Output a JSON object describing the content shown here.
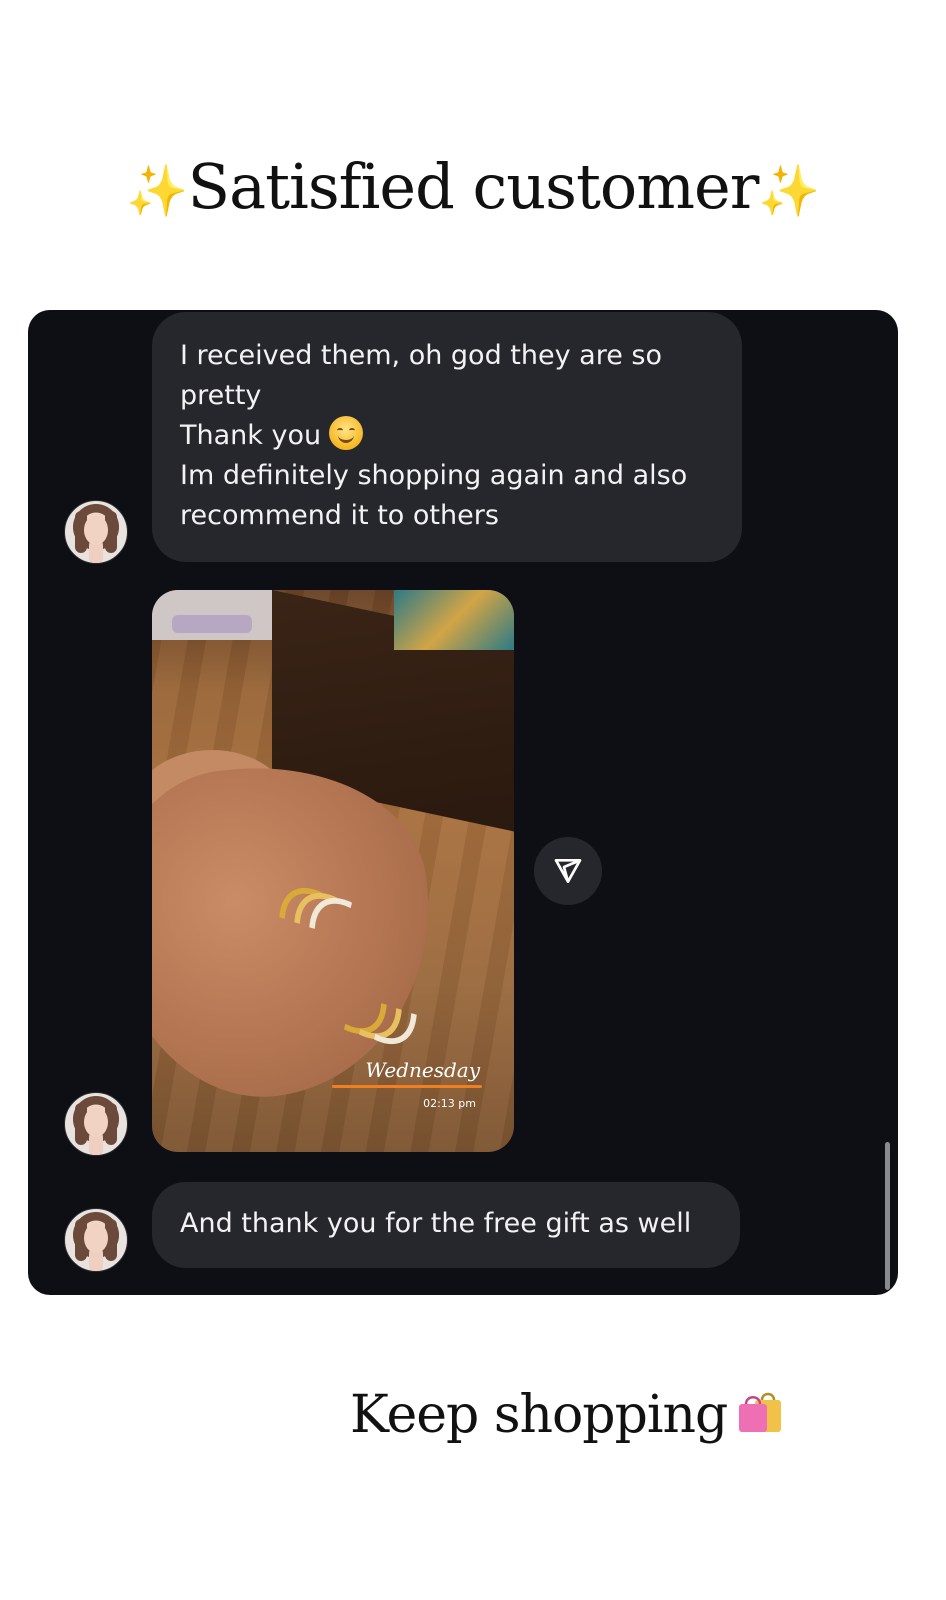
{
  "headline": {
    "spark_left": "✨",
    "text": "Satisfied customer",
    "spark_right": "✨"
  },
  "chat": {
    "messages": [
      {
        "type": "text",
        "lines": [
          "I received them, oh god they are so",
          "pretty",
          "Thank you",
          "Im definitely shopping again and also",
          "recommend it to others"
        ],
        "emoji": "smiling-face"
      },
      {
        "type": "image",
        "watermark_day": "Wednesday",
        "watermark_time": "02:13 pm"
      },
      {
        "type": "text",
        "lines": [
          "And thank you for the free gift as well"
        ]
      }
    ],
    "colors": {
      "background": "#0e0f14",
      "bubble": "#26272d",
      "text": "#f2f2f4"
    }
  },
  "footer": {
    "text": "Keep shopping",
    "icon": "shopping-bags-icon"
  }
}
